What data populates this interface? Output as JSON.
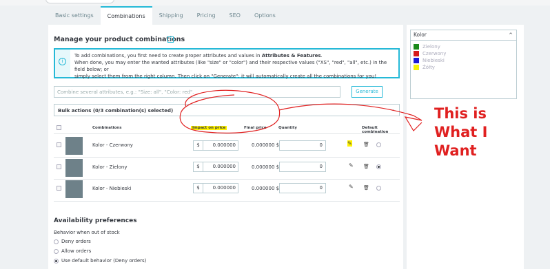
{
  "tabs": [
    "Basic settings",
    "Combinations",
    "Shipping",
    "Pricing",
    "SEO",
    "Options"
  ],
  "active_tab": "Combinations",
  "section_title": "Manage your product combinations",
  "help_icon": "?",
  "info": {
    "line1_pre": "To add combinations, you first need to create proper attributes and values in ",
    "line1_bold": "Attributes & Features",
    "line1_post": ".",
    "line2": "When done, you may enter the wanted attributes (like \"size\" or \"color\") and their respective values (\"XS\", \"red\", \"all\", etc.) in the field below; or",
    "line3": "simply select them from the right column. Then click on \"Generate\": it will automatically create all the combinations for you!"
  },
  "combine_placeholder": "Combine several attributes, e.g.: \"Size: all\", \"Color: red\".",
  "generate_label": "Generate",
  "bulk_label": "Bulk actions (0/3 combination(s) selected)",
  "headers": {
    "combinations": "Combinations",
    "impact": "Impact on price",
    "final": "Final price",
    "quantity": "Quantity",
    "default": "Default combination"
  },
  "rows": [
    {
      "name": "Kolor - Czerwony",
      "currency": "$",
      "impact": "0.000000",
      "final": "0.000000 $",
      "qty": "0",
      "default": false
    },
    {
      "name": "Kolor - Zielony",
      "currency": "$",
      "impact": "0.000000",
      "final": "0.000000 $",
      "qty": "0",
      "default": true
    },
    {
      "name": "Kolor - Niebieski",
      "currency": "$",
      "impact": "0.000000",
      "final": "0.000000 $",
      "qty": "0",
      "default": false
    }
  ],
  "availability": {
    "title": "Availability preferences",
    "label": "Behavior when out of stock",
    "options": [
      "Deny orders",
      "Allow orders",
      "Use default behavior (Deny orders)"
    ],
    "selected": 2
  },
  "attribute_select": {
    "selected": "Kolor",
    "items": [
      {
        "label": "Zielony",
        "color": "#1a8a1a"
      },
      {
        "label": "Czerwony",
        "color": "#d61a1a"
      },
      {
        "label": "Niebieski",
        "color": "#1a1ad6"
      },
      {
        "label": "Żółty",
        "color": "#f2f20a"
      }
    ]
  },
  "annotation": [
    "This is",
    "What I",
    "Want"
  ],
  "icons": {
    "edit": "pencil-icon",
    "delete": "trash-icon",
    "info": "info-icon",
    "caret": "caret-up-icon",
    "chevron": "chevron-down-icon"
  },
  "colors": {
    "accent": "#25b9d7",
    "highlight": "#fff200",
    "annotation": "#e02020"
  }
}
